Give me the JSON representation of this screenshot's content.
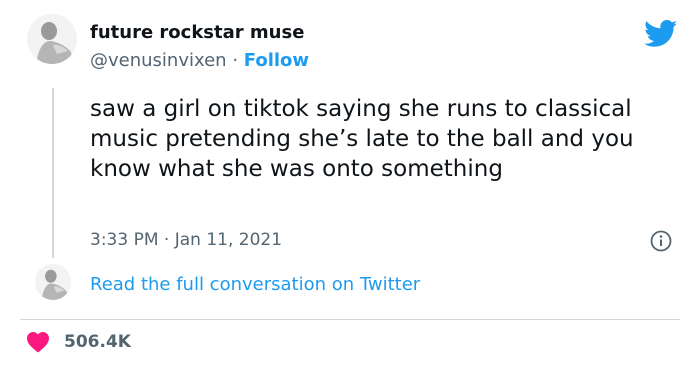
{
  "author": {
    "display_name": "future rockstar muse",
    "handle": "@venusinvixen",
    "separator": "·",
    "follow_label": "Follow"
  },
  "tweet": {
    "text": "saw a girl on tiktok saying she runs to classical music pretending she’s late to the ball and you know what she was onto something",
    "timestamp": "3:33 PM · Jan 11, 2021"
  },
  "thread": {
    "link_label": "Read the full conversation on Twitter"
  },
  "engagement": {
    "likes": "506.4K"
  },
  "colors": {
    "accent": "#1d9bf0",
    "like": "#f91880",
    "muted": "#536471"
  },
  "icons": [
    "twitter-bird-icon",
    "info-icon",
    "heart-icon"
  ]
}
